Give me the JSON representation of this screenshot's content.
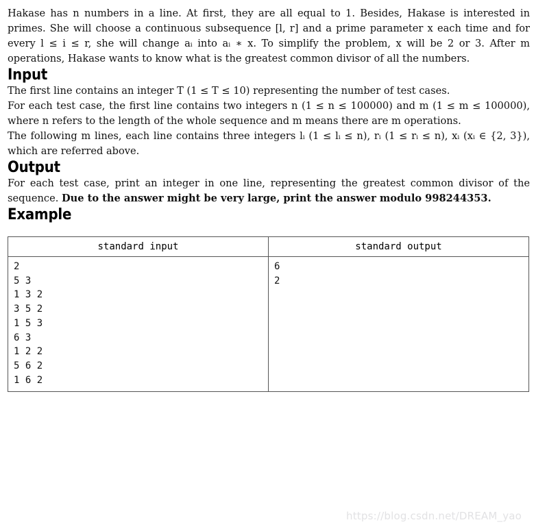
{
  "problem": {
    "statement_line1": "Hakase has n numbers in a line. At first, they are all equal to 1. Besides, Hakase is interested in primes. She will choose a continuous subsequence [l, r] and a prime parameter x each time and for every l ≤ i ≤ r, she will change aᵢ into aᵢ ∗ x. To simplify the problem, x will be 2 or 3. After m operations, Hakase wants to know what is the greatest common divisor of all the numbers."
  },
  "input_section": {
    "heading": "Input",
    "paragraph1": "The first line contains an integer T (1 ≤ T ≤ 10) representing the number of test cases.",
    "paragraph2": "For each test case, the first line contains two integers n (1 ≤ n ≤ 100000) and m (1 ≤ m ≤ 100000), where n refers to the length of the whole sequence and m means there are m operations.",
    "paragraph3": "The following m lines, each line contains three integers lᵢ (1 ≤ lᵢ ≤ n), rᵢ (1 ≤ rᵢ ≤ n), xᵢ (xᵢ ∈ {2, 3}), which are referred above."
  },
  "output_section": {
    "heading": "Output",
    "paragraph_normal": "For each test case, print an integer in one line, representing the greatest common divisor of the sequence. ",
    "paragraph_bold": "Due to the answer might be very large, print the answer modulo 998244353."
  },
  "example_section": {
    "heading": "Example",
    "table": {
      "headers": [
        "standard input",
        "standard output"
      ],
      "standard_input": "2\n5 3\n1 3 2\n3 5 2\n1 5 3\n6 3\n1 2 2\n5 6 2\n1 6 2",
      "standard_output": "6\n2"
    }
  },
  "watermark": {
    "text": "https://blog.csdn.net/DREAM_yao"
  },
  "colors": {
    "text": "#111111",
    "border": "#555555",
    "watermark": "#e2e2e4",
    "background": "#ffffff"
  }
}
